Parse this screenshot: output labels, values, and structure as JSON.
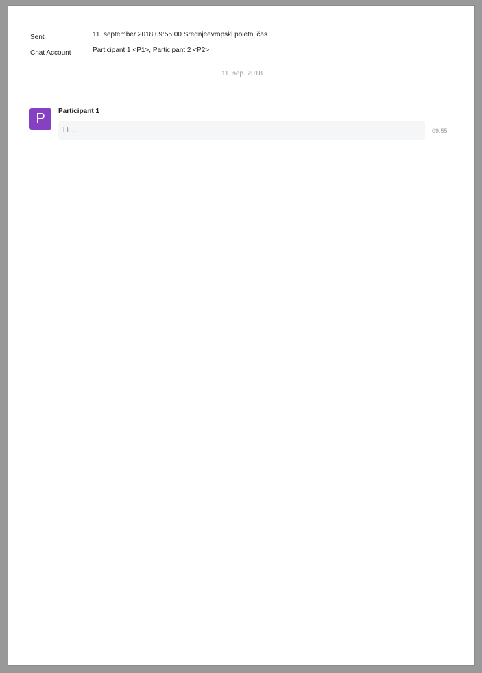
{
  "header": {
    "sent_label": "Sent",
    "sent_value": "11. september 2018 09:55:00 Srednjeevropski poletni čas",
    "chat_account_label": "Chat Account",
    "chat_account_value": "Participant 1 <P1>, Participant 2 <P2>"
  },
  "date_separator": "11. sep. 2018",
  "messages": [
    {
      "avatar_initial": "P",
      "avatar_color": "#8640c2",
      "sender": "Participant 1",
      "text": "Hi...",
      "time": "09:55"
    }
  ]
}
